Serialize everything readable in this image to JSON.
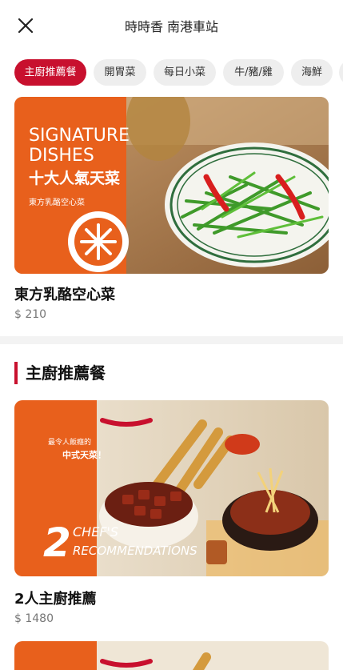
{
  "header": {
    "title": "時時香 南港車站",
    "close_icon": "close-icon"
  },
  "categories": [
    {
      "label": "主廚推薦餐",
      "active": true
    },
    {
      "label": "開胃菜",
      "active": false
    },
    {
      "label": "每日小菜",
      "active": false
    },
    {
      "label": "牛/豬/雞",
      "active": false
    },
    {
      "label": "海鮮",
      "active": false
    }
  ],
  "featured": {
    "banner": {
      "line1": "SIGNATURE",
      "line2": "DISHES",
      "headline": "十大人氣天菜",
      "caption": "東方乳酪空心菜"
    },
    "name": "東方乳酪空心菜",
    "price": "$ 210"
  },
  "section": {
    "title": "主廚推薦餐",
    "items": [
      {
        "banner": {
          "tagline_1": "最令人飯癮的",
          "tagline_2": "中式天菜！",
          "number": "2",
          "text_1": "CHEF'S",
          "text_2": "RECOMMENDATIONS"
        },
        "name": "2人主廚推薦",
        "price": "$ 1480"
      }
    ]
  },
  "colors": {
    "brand_red": "#c8102e",
    "banner_orange": "#e8601c"
  }
}
